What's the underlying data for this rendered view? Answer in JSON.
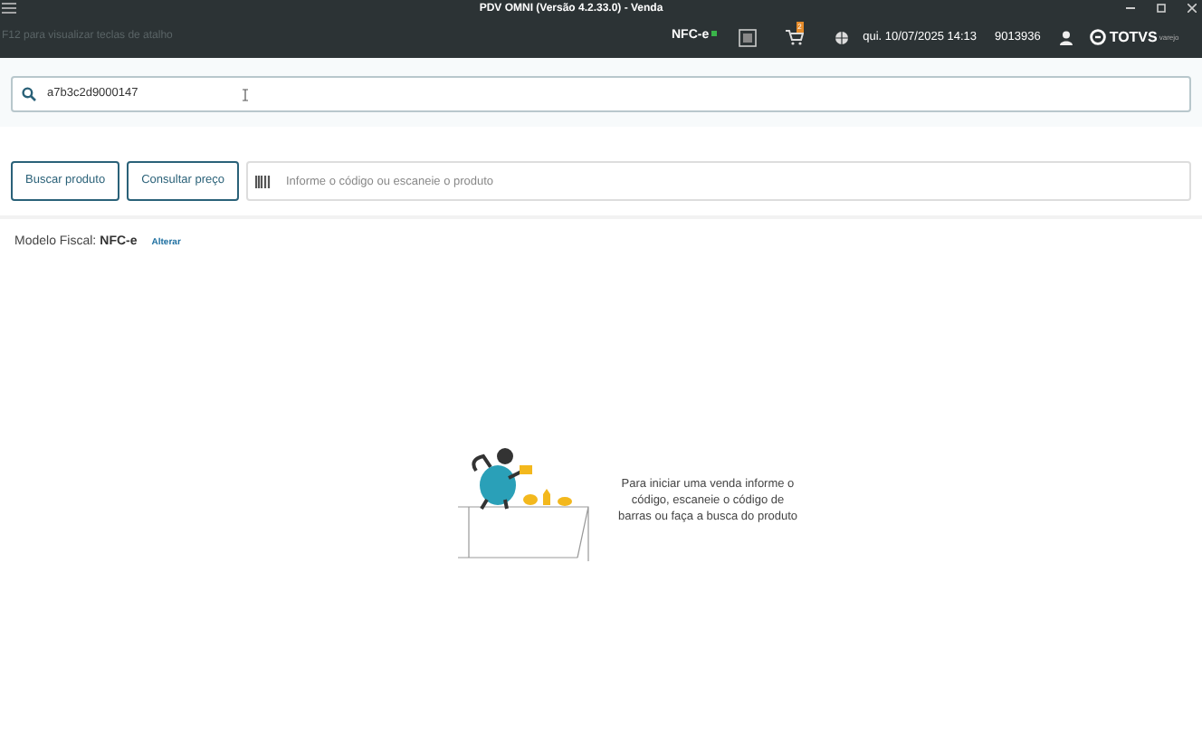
{
  "window": {
    "title": "PDV OMNI (Versão 4.2.33.0) - Venda"
  },
  "header": {
    "hint": "F12 para visualizar teclas de atalho",
    "fiscal_badge": "NFC-e",
    "cart_count": "2",
    "datetime": "qui. 10/07/2025 14:13",
    "operator": "9013936",
    "brand": "TOTVS",
    "brand_sub": "varejo"
  },
  "search": {
    "value": "a7b3c2d9000147"
  },
  "buttons": [
    "Buscar produto",
    "Consultar preço"
  ],
  "product_field": {
    "placeholder": "Informe o código ou escaneie o produto"
  },
  "fiscal": {
    "label": "Modelo Fiscal:",
    "value": "NFC-e",
    "link": "Alterar"
  },
  "empty_state": {
    "message": "Para iniciar uma venda informe o código, escaneie o código de barras ou faça a busca do produto"
  }
}
